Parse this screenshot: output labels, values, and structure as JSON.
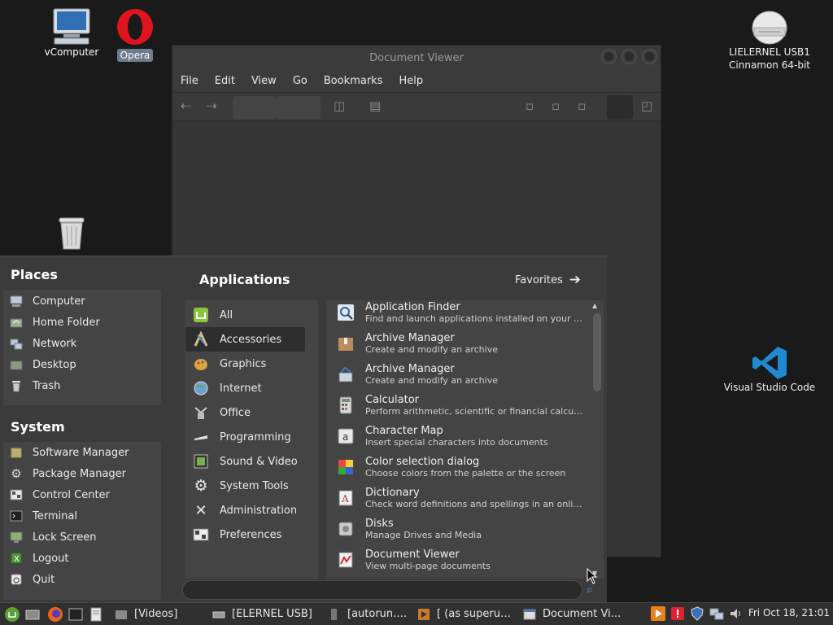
{
  "desktop": {
    "icons": [
      {
        "label": "vComputer",
        "label_overlap": "Computer"
      },
      {
        "label": "Opera"
      },
      {
        "label": "Trash"
      },
      {
        "label": "LIELERNEL USB1",
        "label2": "Cinnamon 64-bit"
      },
      {
        "label": "Visual Studio Code"
      }
    ]
  },
  "doc_viewer": {
    "title": "Document Viewer",
    "menu": [
      "File",
      "Edit",
      "View",
      "Go",
      "Bookmarks",
      "Help"
    ]
  },
  "menu": {
    "places_title": "Places",
    "places": [
      "Computer",
      "Home Folder",
      "Network",
      "Desktop",
      "Trash"
    ],
    "system_title": "System",
    "system": [
      "Software Manager",
      "Package Manager",
      "Control Center",
      "Terminal",
      "Lock Screen",
      "Logout",
      "Quit"
    ],
    "applications_title": "Applications",
    "favorites_label": "Favorites",
    "categories": [
      "All",
      "Accessories",
      "Graphics",
      "Internet",
      "Office",
      "Programming",
      "Sound & Video",
      "System Tools",
      "Administration",
      "Preferences"
    ],
    "active_category": "Accessories",
    "apps": [
      {
        "name": "Application Finder",
        "desc": "Find and launch applications installed on your syst..."
      },
      {
        "name": "Archive Manager",
        "desc": "Create and modify an archive"
      },
      {
        "name": "Archive Manager",
        "desc": "Create and modify an archive"
      },
      {
        "name": "Calculator",
        "desc": "Perform arithmetic, scientific or financial calculations"
      },
      {
        "name": "Character Map",
        "desc": "Insert special characters into documents"
      },
      {
        "name": "Color selection dialog",
        "desc": "Choose colors from the palette or the screen"
      },
      {
        "name": "Dictionary",
        "desc": "Check word definitions and spellings in an online d..."
      },
      {
        "name": "Disks",
        "desc": "Manage Drives and Media"
      },
      {
        "name": "Document Viewer",
        "desc": "View multi-page documents"
      }
    ],
    "search_value": ""
  },
  "taskbar": {
    "tasks": [
      "[Videos]",
      "[ELERNEL USB]",
      "[autorun.ico]",
      "[ (as superus...",
      "Document Vi..."
    ],
    "clock": "Fri Oct 18, 21:01"
  }
}
